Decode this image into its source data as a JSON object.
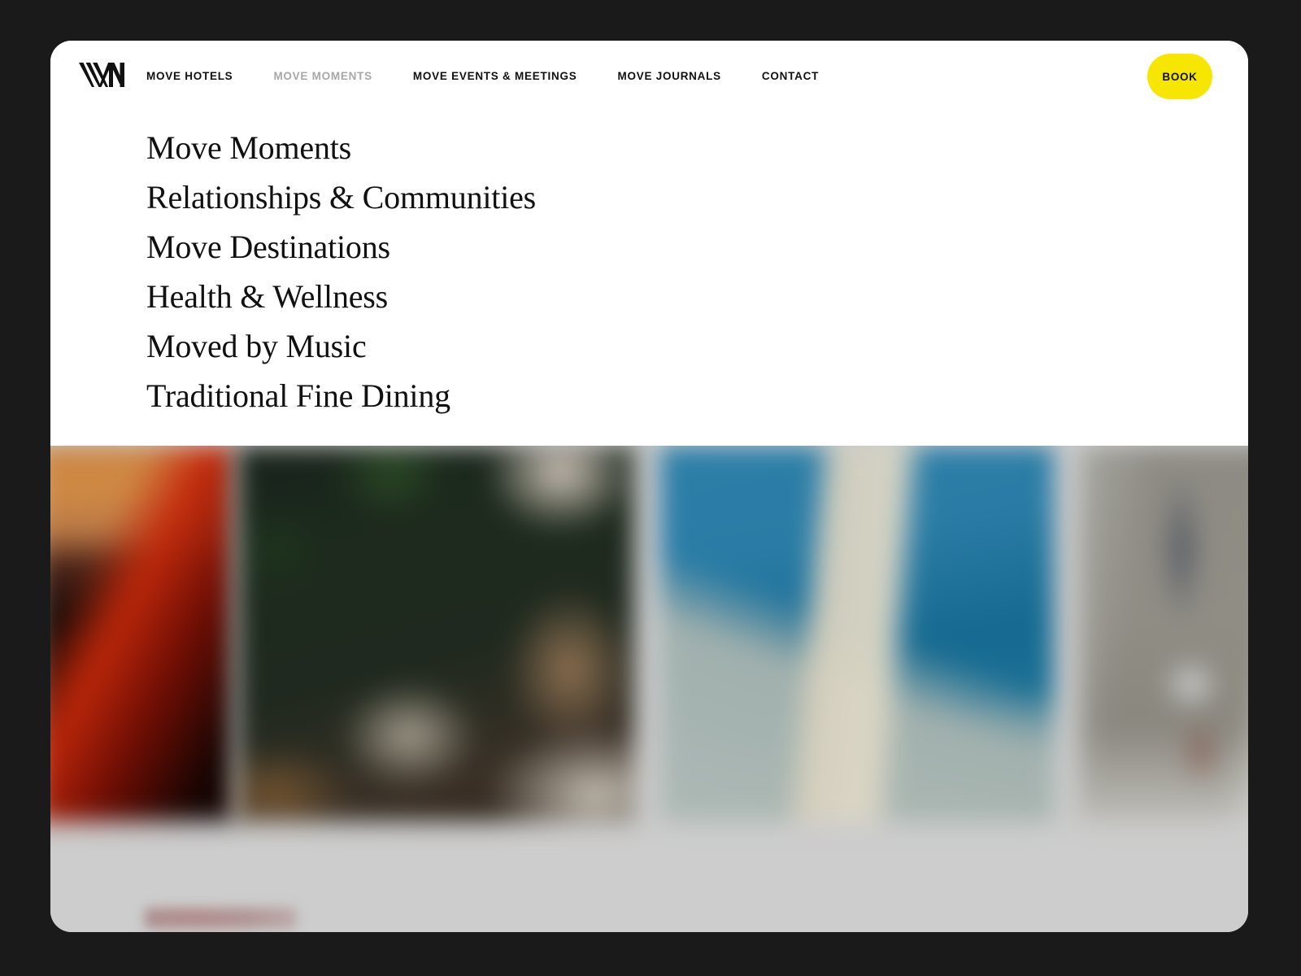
{
  "window": {
    "background_color": "#1a1a1a",
    "surface_color": "#ffffff"
  },
  "header": {
    "logo_name": "WM",
    "nav": [
      {
        "label": "MOVE HOTELS",
        "active": false
      },
      {
        "label": "MOVE MOMENTS",
        "active": true
      },
      {
        "label": "MOVE EVENTS & MEETINGS",
        "active": false
      },
      {
        "label": "MOVE JOURNALS",
        "active": false
      },
      {
        "label": "CONTACT",
        "active": false
      }
    ],
    "book_label": "BOOK",
    "book_color": "#f7e600",
    "active_link_color": "#a8a8a8",
    "link_color": "#111111"
  },
  "dropdown": {
    "items": [
      {
        "label": "Move Moments"
      },
      {
        "label": "Relationships & Communities"
      },
      {
        "label": "Move Destinations"
      },
      {
        "label": "Health & Wellness"
      },
      {
        "label": "Moved by Music"
      },
      {
        "label": "Traditional Fine Dining"
      }
    ]
  },
  "content": {
    "background_color": "#cdcdcd",
    "cards": [
      {
        "name": "sunset-red-drape",
        "dominant_color": "#c4280a"
      },
      {
        "name": "green-interior-lounge",
        "dominant_color": "#1d2a1d"
      },
      {
        "name": "blue-sea-column",
        "dominant_color": "#2d7fa8"
      },
      {
        "name": "gray-beige-room",
        "dominant_color": "#8d8a83"
      }
    ]
  }
}
